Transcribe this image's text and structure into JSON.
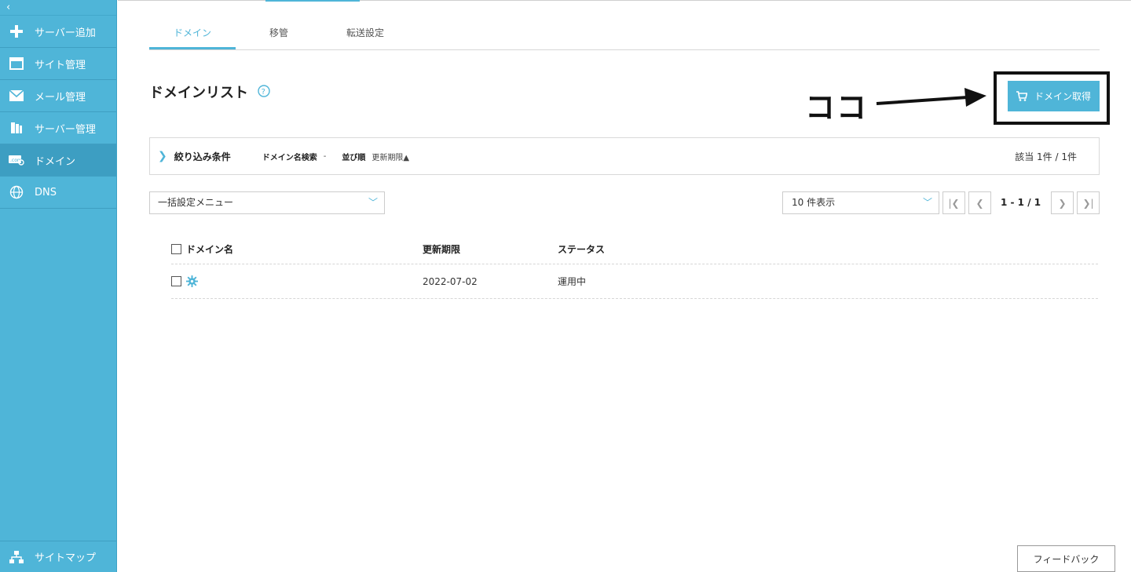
{
  "sidebar": {
    "collapse_glyph": "‹",
    "items": [
      {
        "label": "サーバー追加",
        "icon": "plus-icon"
      },
      {
        "label": "サイト管理",
        "icon": "window-icon"
      },
      {
        "label": "メール管理",
        "icon": "mail-icon"
      },
      {
        "label": "サーバー管理",
        "icon": "server-icon"
      },
      {
        "label": "ドメイン",
        "icon": "domain-icon",
        "active": true
      },
      {
        "label": "DNS",
        "icon": "globe-icon"
      }
    ],
    "sitemap_label": "サイトマップ"
  },
  "tabs": [
    "ドメイン",
    "移管",
    "転送設定"
  ],
  "page_title": "ドメインリスト",
  "annotation": {
    "text": "ココ"
  },
  "get_domain_button": "ドメイン取得",
  "filter": {
    "label": "絞り込み条件",
    "search_key": "ドメイン名検索",
    "search_value": "-",
    "sort_key": "並び順",
    "sort_value": "更新期限▲",
    "count": "該当 1件 / 1件"
  },
  "bulk_menu": "一括設定メニュー",
  "per_page": "10 件表示",
  "pager": {
    "info": "1 - 1 / 1"
  },
  "table": {
    "headers": [
      "ドメイン名",
      "更新期限",
      "ステータス"
    ],
    "rows": [
      {
        "domain": "",
        "expiry": "2022-07-02",
        "status": "運用中"
      }
    ]
  },
  "feedback": "フィードバック",
  "colors": {
    "accent": "#4fb5d8",
    "sidebar": "#4fb5d8"
  }
}
